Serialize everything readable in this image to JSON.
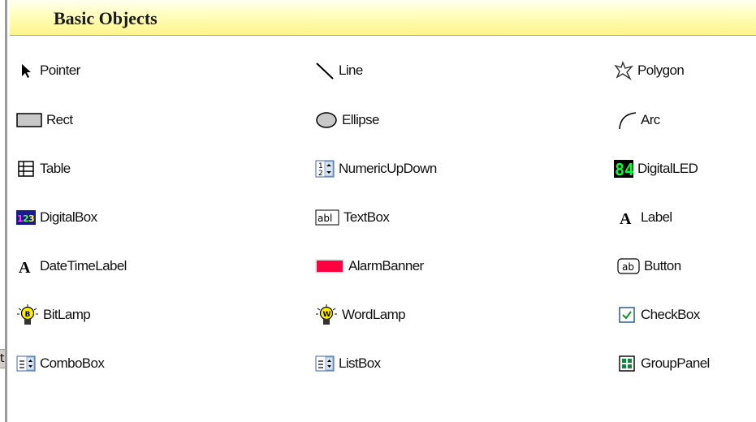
{
  "panel": {
    "title": "Basic Objects"
  },
  "left_stub_char": "t",
  "items": [
    {
      "label": "Pointer",
      "icon": "pointer-icon"
    },
    {
      "label": "Line",
      "icon": "line-icon"
    },
    {
      "label": "Polygon",
      "icon": "polygon-icon"
    },
    {
      "label": "Rect",
      "icon": "rect-icon"
    },
    {
      "label": "Ellipse",
      "icon": "ellipse-icon"
    },
    {
      "label": "Arc",
      "icon": "arc-icon"
    },
    {
      "label": "Table",
      "icon": "table-icon"
    },
    {
      "label": "NumericUpDown",
      "icon": "numeric-updown-icon"
    },
    {
      "label": "DigitalLED",
      "icon": "digital-led-icon"
    },
    {
      "label": "DigitalBox",
      "icon": "digital-box-icon"
    },
    {
      "label": "TextBox",
      "icon": "textbox-icon"
    },
    {
      "label": "Label",
      "icon": "label-icon"
    },
    {
      "label": "DateTimeLabel",
      "icon": "datetime-label-icon"
    },
    {
      "label": "AlarmBanner",
      "icon": "alarm-banner-icon"
    },
    {
      "label": "Button",
      "icon": "button-icon"
    },
    {
      "label": "BitLamp",
      "icon": "bitlamp-icon"
    },
    {
      "label": "WordLamp",
      "icon": "wordlamp-icon"
    },
    {
      "label": "CheckBox",
      "icon": "checkbox-icon"
    },
    {
      "label": "ComboBox",
      "icon": "combobox-icon"
    },
    {
      "label": "ListBox",
      "icon": "listbox-icon"
    },
    {
      "label": "GroupPanel",
      "icon": "group-panel-icon"
    }
  ],
  "icon_text": {
    "numeric_top": "1",
    "numeric_bottom": "2",
    "led_digits": "84",
    "digital_box_digits": "123",
    "textbox_text": "abl",
    "label_glyph": "A",
    "datetime_glyph": "A",
    "button_text": "ab",
    "bitlamp_letter": "B",
    "wordlamp_letter": "W"
  },
  "colors": {
    "header_yellow": "#fdf38a",
    "alarm_red": "#ff0040",
    "led_green": "#00ff33",
    "checkbox_green": "#1a8a2a",
    "group_panel_green": "#0a8a3a",
    "digital_box_navy": "#1a1a8a"
  }
}
